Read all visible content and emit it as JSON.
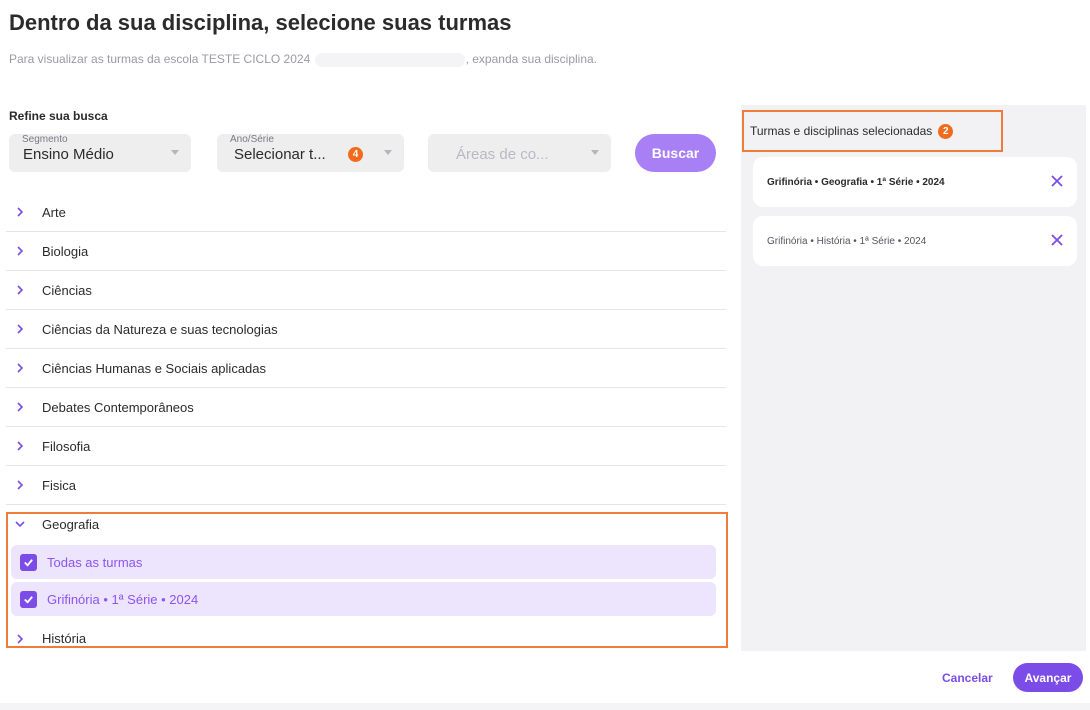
{
  "header": {
    "title": "Dentro da sua disciplina, selecione suas turmas",
    "subtitle_prefix": "Para visualizar as turmas da escola TESTE CICLO 2024",
    "subtitle_suffix": ", expanda sua disciplina."
  },
  "filters": {
    "label": "Refine sua busca",
    "segmento": {
      "label": "Segmento",
      "value": "Ensino Médio"
    },
    "ano_serie": {
      "label": "Ano/Série",
      "value": "Selecionar t...",
      "count": "4"
    },
    "areas": {
      "placeholder": "Áreas de co..."
    },
    "search_label": "Buscar"
  },
  "disciplines_before": [
    "Arte",
    "Biologia",
    "Ciências",
    "Ciências da Natureza e suas tecnologias",
    "Ciências Humanas e Sociais aplicadas",
    "Debates Contemporâneos",
    "Filosofia",
    "Fisica"
  ],
  "expanded": {
    "name": "Geografia",
    "options": [
      {
        "label": "Todas as turmas",
        "checked": true
      },
      {
        "label": "Grifinória • 1ª Série • 2024",
        "checked": true
      }
    ]
  },
  "disciplines_after": [
    "História"
  ],
  "selected_panel": {
    "title": "Turmas e disciplinas selecionadas",
    "count": "2",
    "items": [
      {
        "label": "Grifinória • Geografia • 1ª Série • 2024"
      },
      {
        "label": "Grifinória • História • 1ª Série • 2024"
      }
    ]
  },
  "footer": {
    "cancel_label": "Cancelar",
    "next_label": "Avançar"
  },
  "colors": {
    "accent": "#7b4ce8",
    "highlight": "#f07b3a",
    "badge": "#f26b1d",
    "selected_bg": "#ede4fd"
  }
}
